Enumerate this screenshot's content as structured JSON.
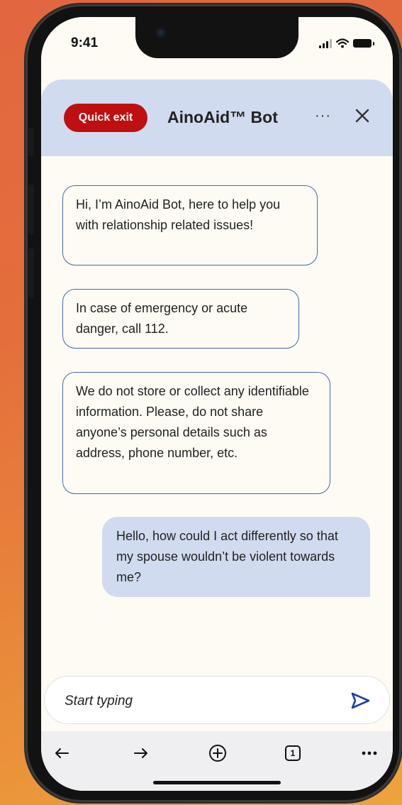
{
  "status_bar": {
    "time": "9:41"
  },
  "header": {
    "quick_exit_label": "Quick exit",
    "title": "AinoAid™ Bot",
    "more_label": "···"
  },
  "messages": [
    {
      "sender": "bot",
      "text": "Hi, I’m AinoAid Bot, here to help you with relationship related issues!"
    },
    {
      "sender": "bot",
      "text": "In case of emergency or acute danger, call 112."
    },
    {
      "sender": "bot",
      "text": "We do not store or collect any identifiable information. Please, do not share anyone’s personal details such as address, phone number, etc."
    },
    {
      "sender": "user",
      "text": "Hello, how could I act differently so that my spouse wouldn’t be violent towards me?"
    }
  ],
  "input": {
    "placeholder": "Start typing"
  },
  "browser_bar": {
    "tab_count": "1"
  },
  "colors": {
    "quick_exit": "#c00f10",
    "header_bg": "#d1dbef",
    "bot_border": "#4a68a6",
    "send_icon": "#1a3fa8"
  }
}
